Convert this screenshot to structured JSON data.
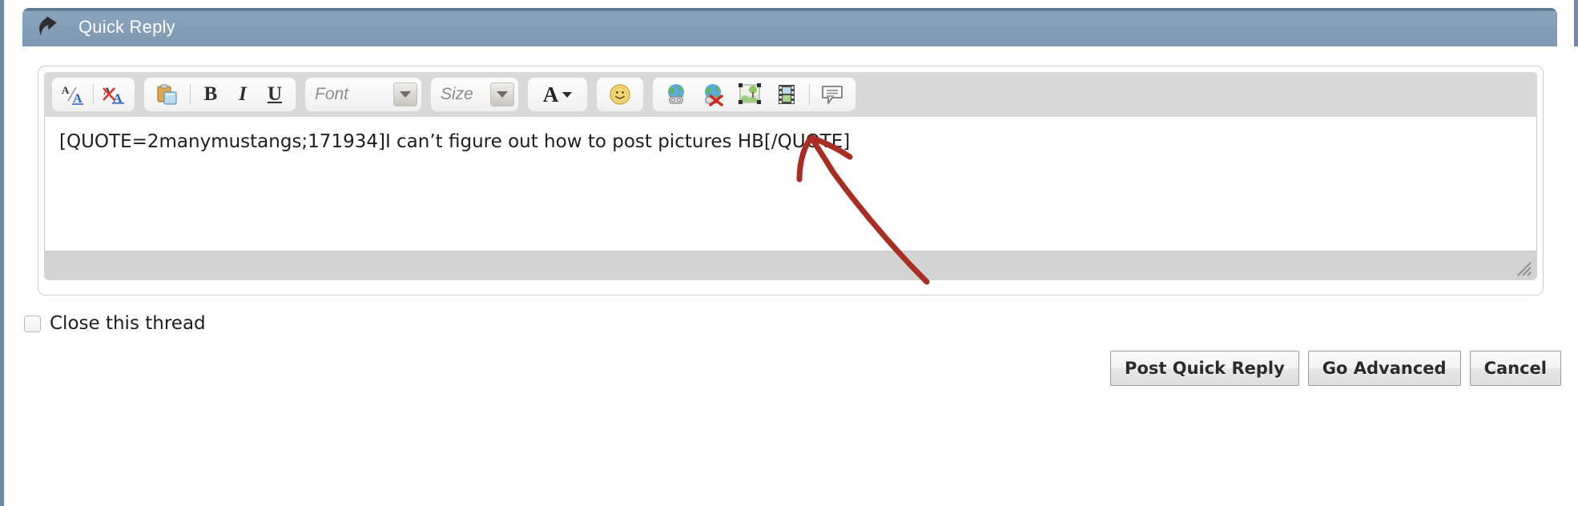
{
  "header": {
    "title": "Quick Reply",
    "back_icon": "reply-arrow-icon",
    "bg_top_color": "#5b7691",
    "bg_bottom_color": "#7e98b2",
    "title_color": "#ffffff"
  },
  "toolbar": {
    "groups": [
      {
        "name": "formatting-toggle-group",
        "buttons": [
          {
            "name": "toggle-editor-mode-button",
            "icon": "a-over-a-icon",
            "title": "A/A"
          },
          {
            "name": "remove-formatting-button",
            "icon": "remove-formatting-icon",
            "title": "A with red X"
          }
        ]
      },
      {
        "name": "text-style-group",
        "buttons": [
          {
            "name": "paste-button",
            "icon": "clipboard-paste-icon",
            "title": "Paste"
          },
          {
            "name": "bold-button",
            "icon": "bold-icon",
            "label": "B"
          },
          {
            "name": "italic-button",
            "icon": "italic-icon",
            "label": "I"
          },
          {
            "name": "underline-button",
            "icon": "underline-icon",
            "label": "U"
          }
        ]
      }
    ],
    "font_select": {
      "name": "font-family-select",
      "placeholder": "Font",
      "value": ""
    },
    "size_select": {
      "name": "font-size-select",
      "placeholder": "Size",
      "value": ""
    },
    "font_color": {
      "name": "font-color-button",
      "icon": "font-color-icon",
      "label": "A"
    },
    "smiley": {
      "name": "insert-smilie-button",
      "icon": "smiley-icon"
    },
    "insert_group": [
      {
        "name": "insert-link-button",
        "icon": "globe-link-icon"
      },
      {
        "name": "remove-link-button",
        "icon": "globe-unlink-icon"
      },
      {
        "name": "insert-image-button",
        "icon": "insert-image-icon"
      },
      {
        "name": "insert-video-button",
        "icon": "film-strip-icon"
      },
      {
        "name": "insert-quote-button",
        "icon": "quote-bubble-icon"
      }
    ]
  },
  "editor": {
    "message_text": "[QUOTE=2manymustangs;171934]I can’t figure out how to post pictures HB[/QUOTE]",
    "resize_grip": "resize-grip-icon"
  },
  "options": {
    "close_thread": {
      "label": "Close this thread",
      "checked": false
    }
  },
  "actions": {
    "post": "Post Quick Reply",
    "advanced": "Go Advanced",
    "cancel": "Cancel"
  },
  "annotation": {
    "type": "hand-drawn-arrow",
    "color": "#a92d22",
    "points_to": "insert-image-button"
  }
}
